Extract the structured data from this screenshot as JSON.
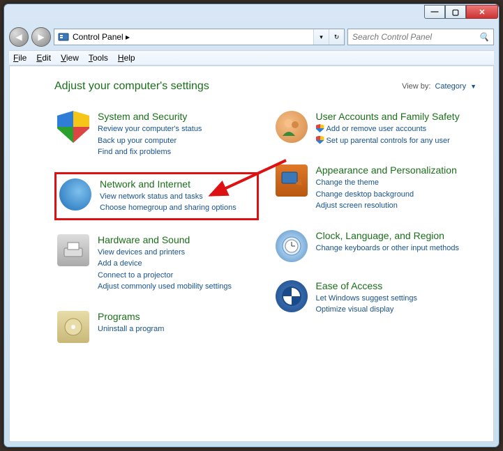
{
  "window": {
    "minimize": "—",
    "maximize": "▢",
    "close": "✕"
  },
  "nav": {
    "back": "◀",
    "forward": "▶",
    "breadcrumb": "Control Panel  ▸",
    "dropdown": "▾",
    "refresh": "↻"
  },
  "search": {
    "placeholder": "Search Control Panel",
    "icon": "🔍"
  },
  "menu": {
    "file": "File",
    "edit": "Edit",
    "view": "View",
    "tools": "Tools",
    "help": "Help"
  },
  "page": {
    "title": "Adjust your computer's settings",
    "view_by_label": "View by:",
    "view_by_value": "Category"
  },
  "cats": {
    "system": {
      "title": "System and Security",
      "l1": "Review your computer's status",
      "l2": "Back up your computer",
      "l3": "Find and fix problems"
    },
    "network": {
      "title": "Network and Internet",
      "l1": "View network status and tasks",
      "l2": "Choose homegroup and sharing options"
    },
    "hardware": {
      "title": "Hardware and Sound",
      "l1": "View devices and printers",
      "l2": "Add a device",
      "l3": "Connect to a projector",
      "l4": "Adjust commonly used mobility settings"
    },
    "programs": {
      "title": "Programs",
      "l1": "Uninstall a program"
    },
    "users": {
      "title": "User Accounts and Family Safety",
      "l1": "Add or remove user accounts",
      "l2": "Set up parental controls for any user"
    },
    "appearance": {
      "title": "Appearance and Personalization",
      "l1": "Change the theme",
      "l2": "Change desktop background",
      "l3": "Adjust screen resolution"
    },
    "clock": {
      "title": "Clock, Language, and Region",
      "l1": "Change keyboards or other input methods"
    },
    "ease": {
      "title": "Ease of Access",
      "l1": "Let Windows suggest settings",
      "l2": "Optimize visual display"
    }
  }
}
